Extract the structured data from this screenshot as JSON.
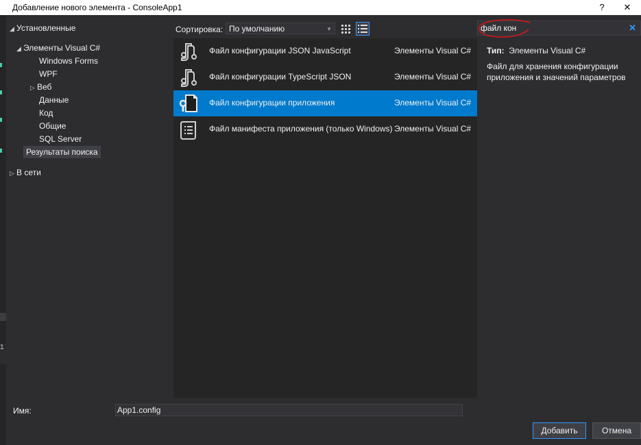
{
  "window": {
    "title": "Добавление нового элемента  - ConsoleApp1",
    "help": "?",
    "close": "✕"
  },
  "tree": {
    "installed": "Установленные",
    "visual_cs": "Элементы Visual C#",
    "children": [
      "Windows Forms",
      "WPF",
      "Веб",
      "Данные",
      "Код",
      "Общие",
      "SQL Server"
    ],
    "search_results": "Результаты поиска",
    "online": "В сети"
  },
  "toolbar": {
    "sort_label": "Сортировка:",
    "sort_value": "По умолчанию"
  },
  "items": [
    {
      "name": "Файл конфигурации JSON JavaScript",
      "category": "Элементы Visual C#",
      "icon": "json-file-icon"
    },
    {
      "name": "Файл конфигурации TypeScript JSON",
      "category": "Элементы Visual C#",
      "icon": "json-file-icon"
    },
    {
      "name": "Файл конфигурации приложения",
      "category": "Элементы Visual C#",
      "icon": "config-file-icon"
    },
    {
      "name": "Файл манифеста приложения (только Windows)",
      "category": "Элементы Visual C#",
      "icon": "manifest-file-icon"
    }
  ],
  "search": {
    "value": "файл кон"
  },
  "details": {
    "type_label": "Тип:",
    "type_value": "Элементы Visual C#",
    "description": "Файл для хранения конфигурации приложения и значений параметров"
  },
  "bottom": {
    "name_label": "Имя:",
    "name_value": "App1.config",
    "add_label": "Добавить",
    "cancel_label": "Отмена"
  },
  "colors": {
    "selection": "#007acc",
    "accent": "#3399ff",
    "annotation": "#e01515"
  }
}
